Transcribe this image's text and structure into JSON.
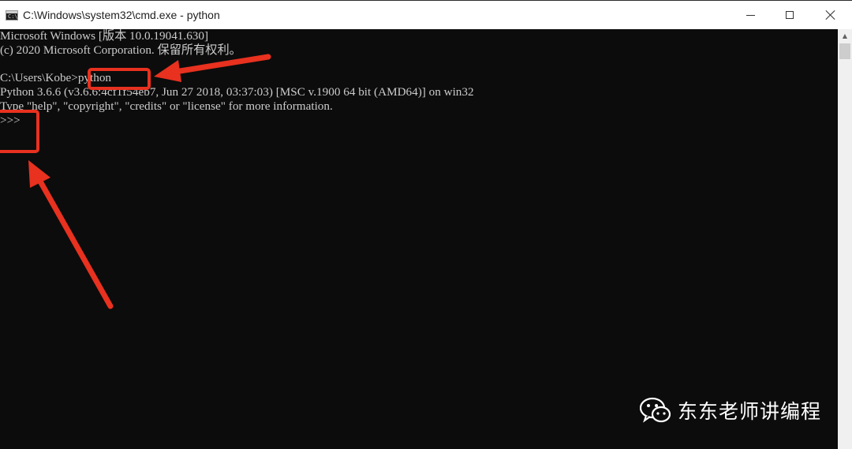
{
  "window": {
    "title": "C:\\Windows\\system32\\cmd.exe - python",
    "icon": "cmd-icon",
    "icon_text": "C:\\",
    "controls": {
      "minimize": "minimize-icon",
      "maximize": "maximize-icon",
      "close": "close-icon"
    }
  },
  "console": {
    "lines": [
      "Microsoft Windows [版本 10.0.19041.630]",
      "(c) 2020 Microsoft Corporation. 保留所有权利。",
      "",
      "C:\\Users\\Kobe>python",
      "Python 3.6.6 (v3.6.6:4cf1f54eb7, Jun 27 2018, 03:37:03) [MSC v.1900 64 bit (AMD64)] on win32",
      "Type \"help\", \"copyright\", \"credits\" or \"license\" for more information.",
      ">>>"
    ],
    "text_color": "#cccccc",
    "background": "#0c0c0c"
  },
  "annotations": {
    "color": "#e8311f",
    "highlights": [
      "python-command",
      "python-prompt"
    ],
    "arrows": 2
  },
  "watermark": {
    "icon": "wechat-icon",
    "text": "东东老师讲编程"
  }
}
